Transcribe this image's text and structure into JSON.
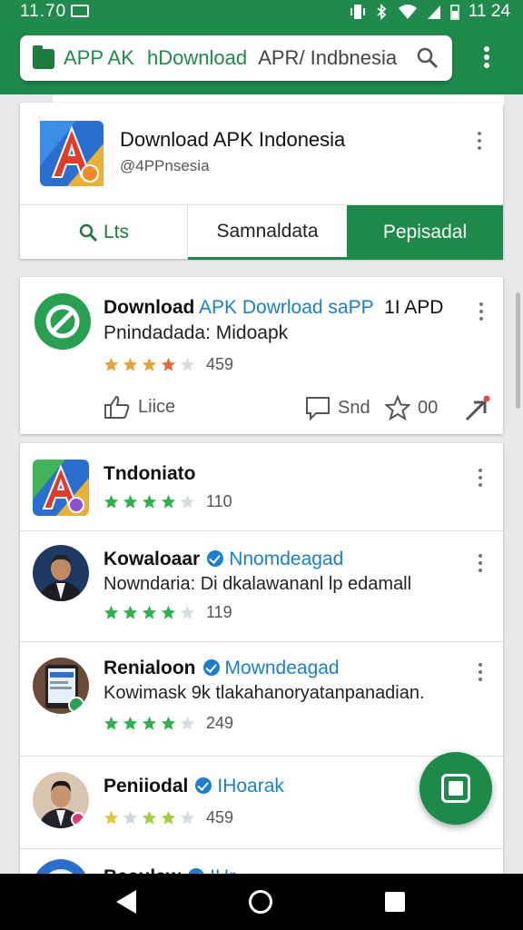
{
  "status_bar": {
    "time_left": "11.70",
    "time_right": "11 24"
  },
  "search": {
    "label": "APP AK",
    "text": "hDownload",
    "muted": "APR/ Indbnesia"
  },
  "profile": {
    "title": "Download APK Indonesia",
    "handle": "@4PPnsesia",
    "tabs": [
      "Lts",
      "Samnaldata",
      "Pepisadal"
    ]
  },
  "post": {
    "title_bold": "Download",
    "title_link": "APK Dowrload saPP",
    "title_tail": "1I APD",
    "subtitle": "Pnindadada: Midoapk",
    "rating": 4,
    "rating_count": "459",
    "like_label": "Liice",
    "share_label": "Snd",
    "fav_count": "00"
  },
  "list": [
    {
      "name": "Tndoniato",
      "handle": "",
      "desc": "",
      "rating": 4,
      "count": "110"
    },
    {
      "name": "Kowaloaar",
      "handle": "Nnomdeagad",
      "desc": "Nowndaria: Di dkalawananl lp edamall",
      "rating": 4,
      "count": "119"
    },
    {
      "name": "Renialoon",
      "handle": "Mowndeagad",
      "desc": "Kowimask 9k tlakahanoryatanpanadian.",
      "rating": 4,
      "count": "249"
    },
    {
      "name": "Peniiodal",
      "handle": "IHoarak",
      "desc": "",
      "rating": 4,
      "count": "459"
    },
    {
      "name": "Baaulaw",
      "handle": "IHr",
      "desc": "",
      "rating": 0,
      "count": ""
    }
  ],
  "colors": {
    "brand_green": "#1e8a4a",
    "link_blue": "#1a7fd0",
    "star_gold": "#e3a53a",
    "star_green": "#2fb24b"
  }
}
